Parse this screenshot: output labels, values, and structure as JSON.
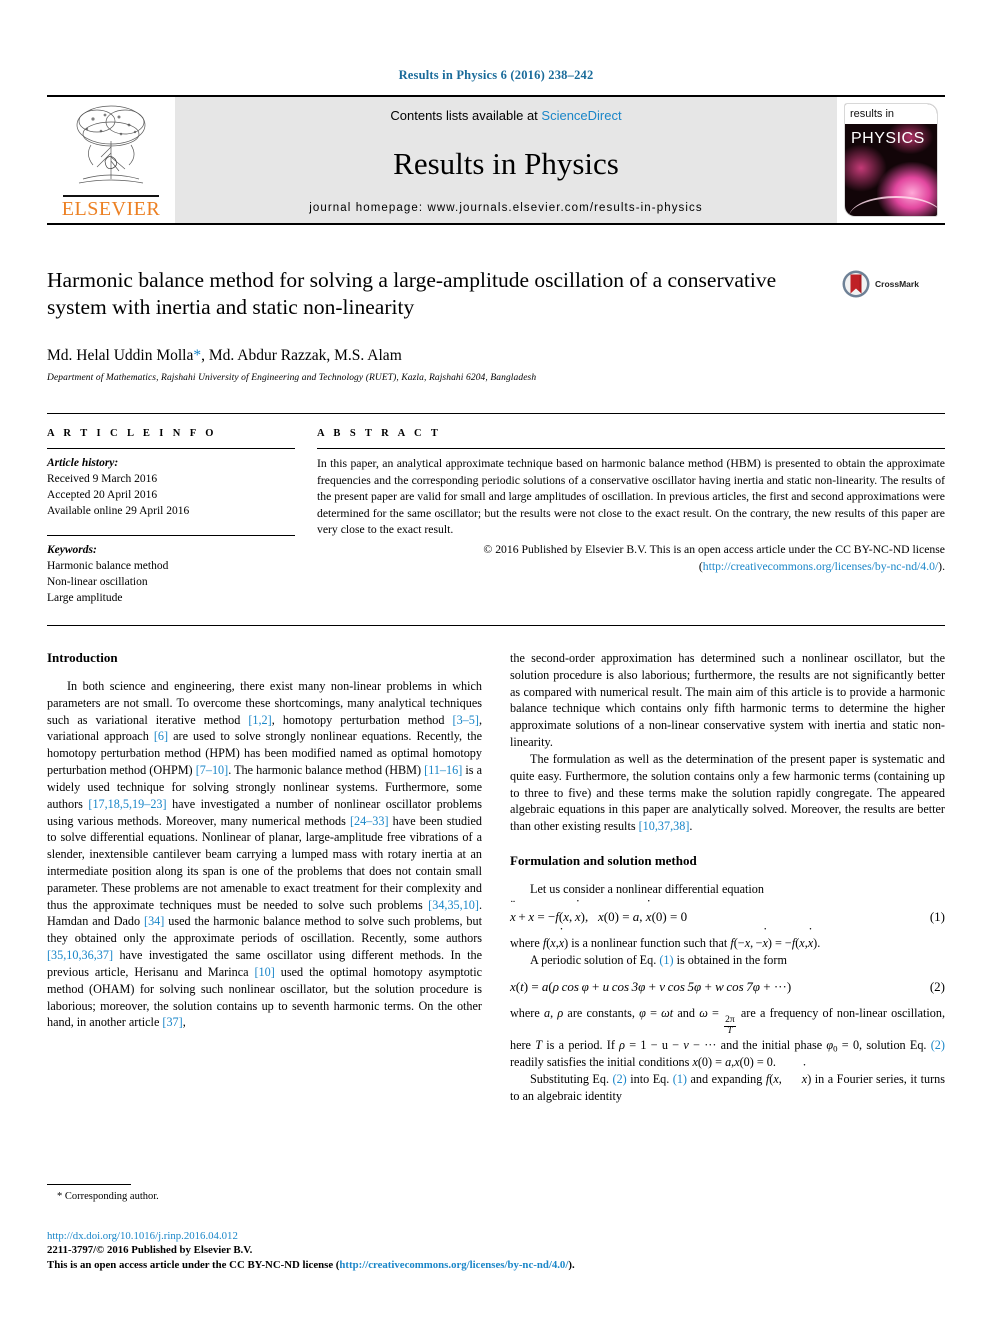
{
  "running_head": "Results in Physics 6 (2016) 238–242",
  "masthead": {
    "publisher_logo_text": "ELSEVIER",
    "contents_prefix": "Contents lists available at ",
    "contents_link": "ScienceDirect",
    "journal_title": "Results in Physics",
    "homepage": "journal homepage: www.journals.elsevier.com/results-in-physics",
    "cover": {
      "line1": "results in",
      "line2": "PHYSICS"
    }
  },
  "article": {
    "title": "Harmonic balance method for solving a large-amplitude oscillation of a conservative system with inertia and static non-linearity",
    "crossmark_label": "CrossMark",
    "authors": "Md. Helal Uddin Molla",
    "author_star": "*",
    "authors_rest": ", Md. Abdur Razzak, M.S. Alam",
    "affiliation": "Department of Mathematics, Rajshahi University of Engineering and Technology (RUET), Kazla, Rajshahi 6204, Bangladesh"
  },
  "info": {
    "heading": "A R T I C L E  I N F O",
    "history_label": "Article history:",
    "history": [
      "Received 9 March 2016",
      "Accepted 20 April 2016",
      "Available online 29 April 2016"
    ],
    "keywords_label": "Keywords:",
    "keywords": [
      "Harmonic balance method",
      "Non-linear oscillation",
      "Large amplitude"
    ]
  },
  "abstract": {
    "heading": "A B S T R A C T",
    "text": "In this paper, an analytical approximate technique based on harmonic balance method (HBM) is presented to obtain the approximate frequencies and the corresponding periodic solutions of a conservative oscillator having inertia and static non-linearity. The results of the present paper are valid for small and large amplitudes of oscillation. In previous articles, the first and second approximations were determined for the same oscillator; but the results were not close to the exact result. On the contrary, the new results of this paper are very close to the exact result.",
    "copyright_prefix": "© 2016 Published by Elsevier B.V. This is an open access article under the CC BY-NC-ND license (",
    "copyright_link": "http://creativecommons.org/licenses/by-nc-nd/4.0/",
    "copyright_suffix": ")."
  },
  "body": {
    "intro_heading": "Introduction",
    "intro_p1_parts": {
      "a": "In both science and engineering, there exist many non-linear problems in which parameters are not small. To overcome these shortcomings, many analytical techniques such as variational iterative method ",
      "r1": "[1,2]",
      "b": ", homotopy perturbation method ",
      "r2": "[3–5]",
      "c": ", variational approach ",
      "r3": "[6]",
      "d": " are used to solve strongly nonlinear equations. Recently, the homotopy perturbation method (HPM) has been modified named as optimal homotopy perturbation method (OHPM) ",
      "r4": "[7–10]",
      "e": ". The harmonic balance method (HBM) ",
      "r5": "[11–16]",
      "f": " is a widely used technique for solving strongly nonlinear systems. Furthermore, some authors ",
      "r6": "[17,18,5,19–23]",
      "g": " have investigated a number of nonlinear oscillator problems using various methods. Moreover, many numerical methods ",
      "r7": "[24–33]",
      "h": " have been studied to solve differential equations. Nonlinear of planar, large-amplitude free vibrations of a slender, inextensible cantilever beam carrying a lumped mass with rotary inertia at an intermediate position along its span is one of the problems that does not contain small parameter. These problems are not amenable to exact treatment for their complexity and thus the approximate techniques must be needed to solve such problems ",
      "r8": "[34,35,10]",
      "i": ". Hamdan and Dado ",
      "r9": "[34]",
      "j": " used the harmonic balance method to solve such problems, but they obtained only the approximate periods of oscillation. Recently, some authors ",
      "r10": "[35,10,36,37]",
      "k": " have investigated the same oscillator using different methods. In the previous article, Herisanu and Marinca ",
      "r11": "[10]",
      "l": " used the optimal homotopy asymptotic method (OHAM) for solving such nonlinear oscillator, but the solution procedure is laborious; moreover, the solution contains up to seventh harmonic terms. On the other hand, in another article ",
      "r12": "[37]",
      "m": ","
    },
    "right_p1": "the second-order approximation has determined such a nonlinear oscillator, but the solution procedure is also laborious; furthermore, the results are not significantly better as compared with numerical result. The main aim of this article is to provide a harmonic balance technique which contains only fifth harmonic terms to determine the higher approximate solutions of a non-linear conservative system with inertia and static non-linearity.",
    "right_p2_parts": {
      "a": "The formulation as well as the determination of the present paper is systematic and quite easy. Furthermore, the solution contains only a few harmonic terms (containing up to three to five) and these terms make the solution rapidly congregate. The appeared algebraic equations in this paper are analytically solved. Moreover, the results are better than other existing results ",
      "r1": "[10,37,38]",
      "b": "."
    },
    "formulation_heading": "Formulation and solution method",
    "form_p1": "Let us consider a nonlinear differential equation",
    "eq1_number": "(1)",
    "eq2_number": "(2)",
    "after_eq1_parts": {
      "a": "where ",
      "b": " is a nonlinear function such that ",
      "c": ".",
      "d": "A periodic solution of Eq. ",
      "e": "(1)",
      "f": " is obtained in the form"
    },
    "after_eq2_parts": {
      "a": "where ",
      "b": " are constants, ",
      "c": " and ",
      "d": " are a frequency of non-linear oscillation, here ",
      "e": " is a period. If ",
      "f": " and the initial phase ",
      "g": ", solution Eq. ",
      "h": "(2)",
      "i": " readily satisfies the initial conditions ",
      "j": ".",
      "k": "Substituting Eq. ",
      "l": "(2)",
      "m": " into Eq. ",
      "n": "(1)",
      "o": " and expanding ",
      "p": " in a Fourier series, it turns to an algebraic identity"
    }
  },
  "footnote": {
    "marker": "*",
    "text": "Corresponding author."
  },
  "footer": {
    "doi": "http://dx.doi.org/10.1016/j.rinp.2016.04.012",
    "issn_line": "2211-3797/© 2016 Published by Elsevier B.V.",
    "license_prefix": "This is an open access article under the CC BY-NC-ND license (",
    "license_link": "http://creativecommons.org/licenses/by-nc-nd/4.0/",
    "license_suffix": ")."
  },
  "colors": {
    "link": "#1a86c8",
    "running_head": "#1a6b9a",
    "elsevier_orange": "#ec8023",
    "banner_gray": "#e6e6e6"
  }
}
